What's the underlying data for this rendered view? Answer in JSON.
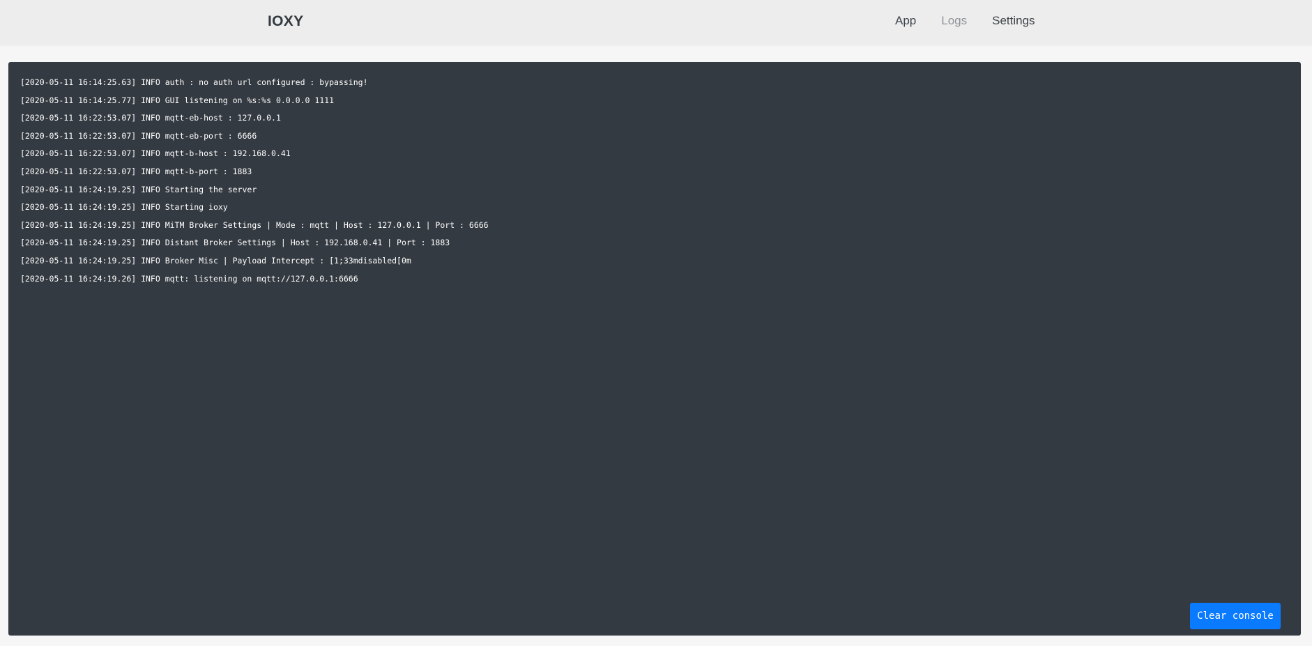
{
  "navbar": {
    "brand": "IOXY",
    "links": [
      {
        "label": "App"
      },
      {
        "label": "Logs"
      },
      {
        "label": "Settings"
      }
    ]
  },
  "console": {
    "lines": [
      "[2020-05-11 16:14:25.63] INFO auth : no auth url configured : bypassing!",
      "[2020-05-11 16:14:25.77] INFO GUI listening on %s:%s 0.0.0.0 1111",
      "[2020-05-11 16:22:53.07] INFO mqtt-eb-host : 127.0.0.1",
      "[2020-05-11 16:22:53.07] INFO mqtt-eb-port : 6666",
      "[2020-05-11 16:22:53.07] INFO mqtt-b-host : 192.168.0.41",
      "[2020-05-11 16:22:53.07] INFO mqtt-b-port : 1883",
      "[2020-05-11 16:24:19.25] INFO Starting the server",
      "[2020-05-11 16:24:19.25] INFO Starting ioxy",
      "[2020-05-11 16:24:19.25] INFO MiTM Broker Settings | Mode : mqtt | Host : 127.0.0.1 | Port : 6666",
      "[2020-05-11 16:24:19.25] INFO Distant Broker Settings | Host : 192.168.0.41 | Port : 1883",
      "[2020-05-11 16:24:19.25] INFO Broker Misc | Payload Intercept : [1;33mdisabled[0m",
      "[2020-05-11 16:24:19.26] INFO mqtt: listening on mqtt://127.0.0.1:6666"
    ],
    "clear_label": "Clear console"
  },
  "colors": {
    "navbar_bg": "#ededed",
    "console_bg": "#343a41",
    "button_bg": "#0a7bff"
  }
}
